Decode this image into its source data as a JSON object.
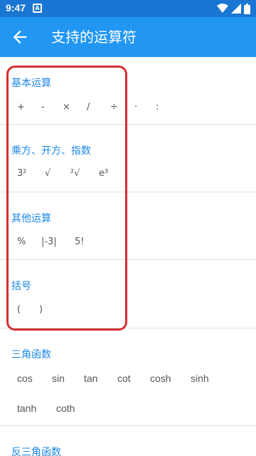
{
  "status_bar": {
    "time": "9:47",
    "notif_letter": "A"
  },
  "app_bar": {
    "title": "支持的运算符"
  },
  "sections": {
    "basic": {
      "title": "基本运算",
      "ops": [
        "+",
        "-",
        "×",
        "/",
        "÷",
        "·",
        ":"
      ]
    },
    "power": {
      "title": "乘方、开方、指数",
      "ops": [
        "3²",
        "√",
        "²√",
        "e³"
      ]
    },
    "other": {
      "title": "其他运算",
      "ops": [
        "%",
        "|-3|",
        "5!"
      ]
    },
    "brackets": {
      "title": "括号",
      "ops": [
        "(",
        ")"
      ]
    },
    "trig": {
      "title": "三角函数",
      "ops": [
        "cos",
        "sin",
        "tan",
        "cot",
        "cosh",
        "sinh",
        "tanh",
        "coth"
      ]
    },
    "inverse_trig": {
      "title": "反三角函数"
    }
  },
  "colors": {
    "status_bar": "#1976d2",
    "app_bar": "#2196f3",
    "section_title": "#1e88e5",
    "highlight": "#d32f2f"
  },
  "icons": {
    "back": "arrow-back-icon",
    "wifi": "wifi-icon",
    "signal": "signal-icon",
    "battery": "battery-icon",
    "notification": "notification-icon"
  }
}
